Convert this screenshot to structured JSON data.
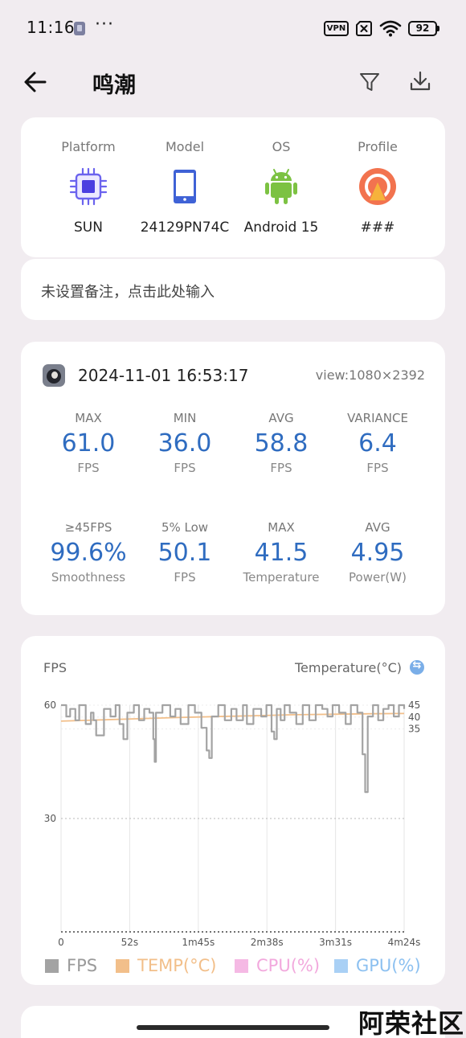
{
  "status_bar": {
    "time": "11:16",
    "dots": "···",
    "vpn": "VPN",
    "battery": "92"
  },
  "header": {
    "title": "鸣潮",
    "icons": [
      "back-arrow-icon",
      "filter-icon",
      "download-icon"
    ]
  },
  "device": [
    {
      "label": "Platform",
      "value": "SUN",
      "icon": "chip-icon"
    },
    {
      "label": "Model",
      "value": "24129PN74C",
      "icon": "phone-icon"
    },
    {
      "label": "OS",
      "value": "Android 15",
      "icon": "android-icon"
    },
    {
      "label": "Profile",
      "value": "###",
      "icon": "profile-icon"
    }
  ],
  "note": {
    "placeholder": "未设置备注，点击此处输入"
  },
  "session": {
    "datetime": "2024-11-01 16:53:17",
    "view": "view:1080×2392",
    "stats_row1": [
      {
        "label": "MAX",
        "value": "61.0",
        "unit": "FPS"
      },
      {
        "label": "MIN",
        "value": "36.0",
        "unit": "FPS"
      },
      {
        "label": "AVG",
        "value": "58.8",
        "unit": "FPS"
      },
      {
        "label": "VARIANCE",
        "value": "6.4",
        "unit": "FPS"
      }
    ],
    "stats_row2": [
      {
        "label": "≥45FPS",
        "value": "99.6%",
        "unit": "Smoothness"
      },
      {
        "label": "5% Low",
        "value": "50.1",
        "unit": "FPS"
      },
      {
        "label": "MAX",
        "value": "41.5",
        "unit": "Temperature"
      },
      {
        "label": "AVG",
        "value": "4.95",
        "unit": "Power(W)"
      }
    ]
  },
  "chart_data": {
    "type": "line",
    "left_axis_label": "FPS",
    "right_axis_label": "Temperature(°C)",
    "left_ticks": [
      "60",
      "30"
    ],
    "left_ylim": [
      0,
      60
    ],
    "right_ticks": [
      "45",
      "40",
      "35"
    ],
    "right_ylim": [
      -50,
      45
    ],
    "x_ticks": [
      "0",
      "52s",
      "1m45s",
      "2m38s",
      "3m31s",
      "4m24s"
    ],
    "x_range_seconds": [
      0,
      264
    ],
    "series": [
      {
        "name": "FPS",
        "color": "#a3a3a3",
        "x": [
          0,
          4,
          7,
          11,
          14,
          19,
          23,
          25,
          27,
          33,
          38,
          42,
          45,
          48,
          51,
          56,
          60,
          64,
          68,
          71,
          72,
          73,
          78,
          84,
          88,
          92,
          98,
          103,
          108,
          112,
          114,
          116,
          121,
          126,
          131,
          135,
          140,
          143,
          148,
          154,
          158,
          162,
          164,
          166,
          169,
          172,
          176,
          181,
          186,
          191,
          196,
          201,
          205,
          209,
          214,
          219,
          223,
          228,
          232,
          234,
          236,
          240,
          244,
          248,
          252,
          256,
          260,
          264
        ],
        "values": [
          60,
          57,
          59,
          56,
          60,
          55,
          58,
          56,
          52,
          59,
          57,
          60,
          55,
          51,
          58,
          60,
          56,
          59,
          58,
          51,
          45,
          58,
          60,
          57,
          59,
          55,
          60,
          58,
          54,
          48,
          46,
          57,
          60,
          56,
          59,
          56,
          60,
          55,
          59,
          57,
          60,
          53,
          51,
          59,
          56,
          60,
          58,
          55,
          60,
          56,
          60,
          59,
          57,
          60,
          58,
          55,
          60,
          58,
          47,
          37,
          57,
          60,
          56,
          59,
          60,
          57,
          60,
          59
        ]
      },
      {
        "name": "TEMP(°C)",
        "color": "#f2bf8a",
        "x": [
          0,
          30,
          60,
          90,
          120,
          150,
          180,
          210,
          240,
          264
        ],
        "values": [
          38.3,
          38.8,
          39.3,
          39.8,
          40.2,
          40.6,
          41.0,
          41.2,
          41.4,
          41.5
        ]
      }
    ],
    "legend": [
      {
        "name": "FPS",
        "color": "#a3a3a3"
      },
      {
        "name": "TEMP(°C)",
        "color": "#f2bf8a"
      },
      {
        "name": "CPU(%)",
        "color": "#f5b9e4"
      },
      {
        "name": "GPU(%)",
        "color": "#a9d0f5"
      }
    ]
  },
  "watermark": "阿荣社区"
}
